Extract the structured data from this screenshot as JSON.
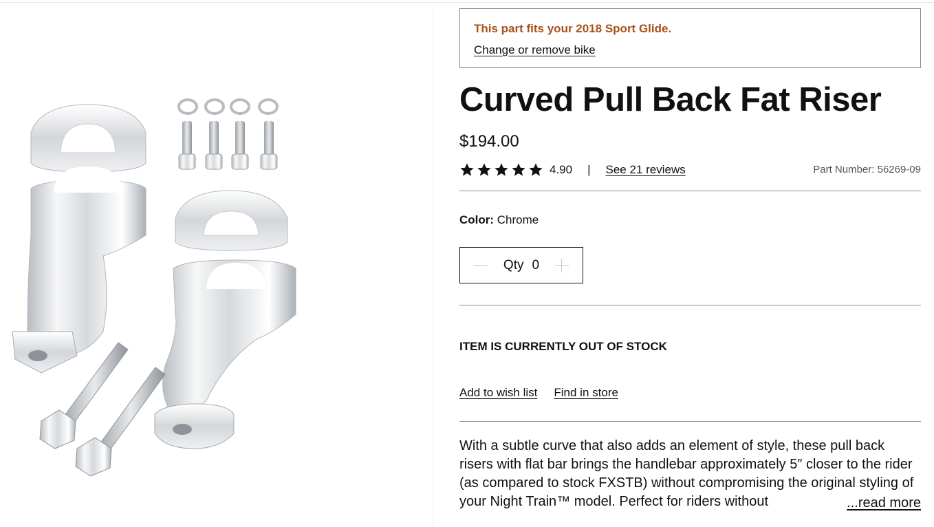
{
  "fitment": {
    "message": "This part fits your 2018 Sport Glide.",
    "change_link": "Change or remove bike"
  },
  "product": {
    "title": "Curved Pull Back Fat Riser",
    "price": "$194.00",
    "rating": "4.90",
    "stars": 5,
    "rating_separator": "|",
    "reviews_link": "See 21 reviews",
    "part_number": "Part Number: 56269-09",
    "image_alt": "Curved Pull Back Fat Riser chrome kit with bolts and washers"
  },
  "color": {
    "label": "Color:",
    "value": "Chrome"
  },
  "quantity": {
    "label": "Qty",
    "value": "0"
  },
  "stock_status": "ITEM IS CURRENTLY OUT OF STOCK",
  "actions": {
    "wishlist": "Add to wish list",
    "find_store": "Find in store"
  },
  "description": {
    "text": "With a subtle curve that also adds an element of style, these pull back risers with flat bar brings the handlebar approximately 5″ closer to the rider (as compared to stock FXSTB) without compromising the original styling of your Night Train™ model. Perfect for riders without",
    "read_more": "...read more"
  },
  "colors": {
    "fitment_text": "#a8501a",
    "text": "#111111",
    "border": "#8a8a8a"
  }
}
